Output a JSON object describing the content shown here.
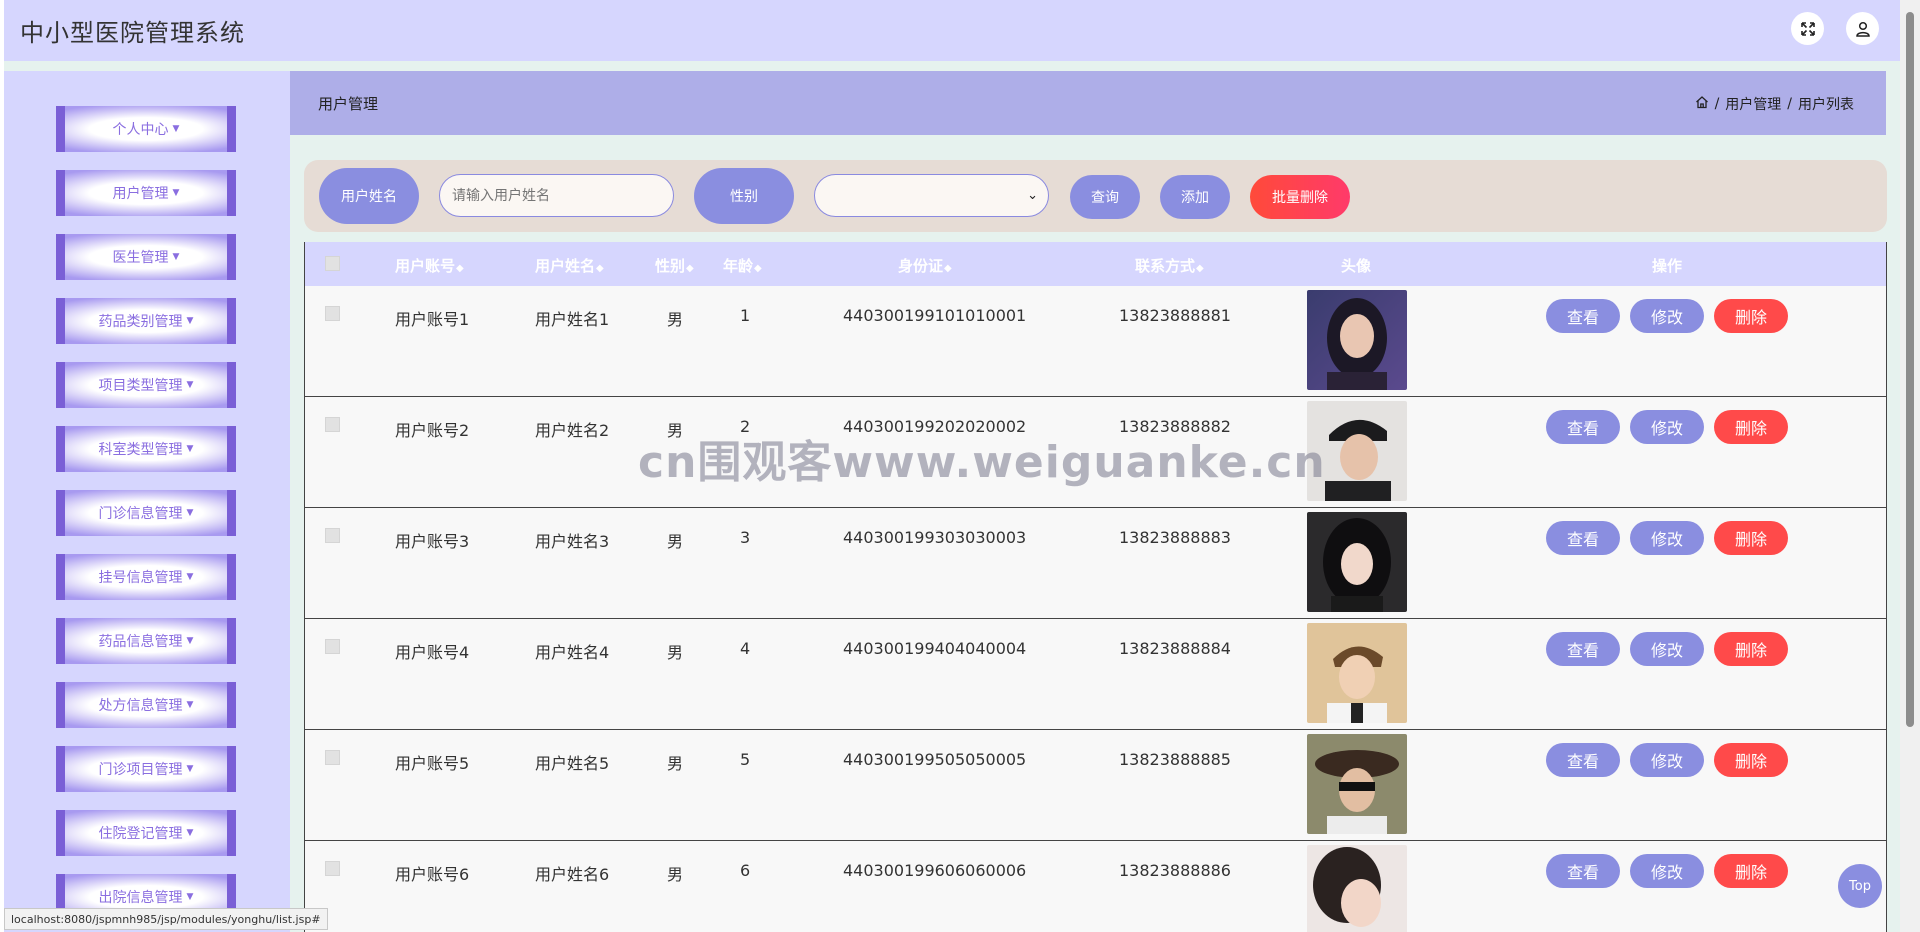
{
  "app": {
    "title": "中小型医院管理系统"
  },
  "header": {
    "fullscreen_icon": "expand-icon",
    "user_icon": "user-icon"
  },
  "sidebar": {
    "items": [
      {
        "label": "个人中心"
      },
      {
        "label": "用户管理"
      },
      {
        "label": "医生管理"
      },
      {
        "label": "药品类别管理"
      },
      {
        "label": "项目类型管理"
      },
      {
        "label": "科室类型管理"
      },
      {
        "label": "门诊信息管理"
      },
      {
        "label": "挂号信息管理"
      },
      {
        "label": "药品信息管理"
      },
      {
        "label": "处方信息管理"
      },
      {
        "label": "门诊项目管理"
      },
      {
        "label": "住院登记管理"
      },
      {
        "label": "出院信息管理"
      }
    ]
  },
  "breadcrumb": {
    "title": "用户管理",
    "home_icon": "home-icon",
    "level1": "用户管理",
    "level2": "用户列表",
    "sep": "/"
  },
  "search": {
    "name_label": "用户姓名",
    "name_placeholder": "请输入用户姓名",
    "gender_label": "性别",
    "gender_value": "",
    "query": "查询",
    "add": "添加",
    "batch_delete": "批量删除"
  },
  "table": {
    "headers": [
      "用户账号",
      "用户姓名",
      "性别",
      "年龄",
      "身份证",
      "联系方式",
      "头像",
      "操作"
    ],
    "sort_icon": "◆",
    "rows": [
      {
        "account": "用户账号1",
        "name": "用户姓名1",
        "gender": "男",
        "age": "1",
        "id_card": "440300199101010001",
        "phone": "13823888881"
      },
      {
        "account": "用户账号2",
        "name": "用户姓名2",
        "gender": "男",
        "age": "2",
        "id_card": "440300199202020002",
        "phone": "13823888882"
      },
      {
        "account": "用户账号3",
        "name": "用户姓名3",
        "gender": "男",
        "age": "3",
        "id_card": "440300199303030003",
        "phone": "13823888883"
      },
      {
        "account": "用户账号4",
        "name": "用户姓名4",
        "gender": "男",
        "age": "4",
        "id_card": "440300199404040004",
        "phone": "13823888884"
      },
      {
        "account": "用户账号5",
        "name": "用户姓名5",
        "gender": "男",
        "age": "5",
        "id_card": "440300199505050005",
        "phone": "13823888885"
      },
      {
        "account": "用户账号6",
        "name": "用户姓名6",
        "gender": "男",
        "age": "6",
        "id_card": "440300199606060006",
        "phone": "13823888886"
      }
    ],
    "actions": {
      "view": "查看",
      "edit": "修改",
      "delete": "删除"
    }
  },
  "watermark": "cn围观客www.weiguanke.cn",
  "top_button": "Top",
  "status_url": "localhost:8080/jspmnh985/jsp/modules/yonghu/list.jsp#",
  "colors": {
    "topbar": "#d6d6fe",
    "breadbar": "#aeaee8",
    "accent": "#8a8ee0",
    "danger": "#ff4a4a"
  }
}
